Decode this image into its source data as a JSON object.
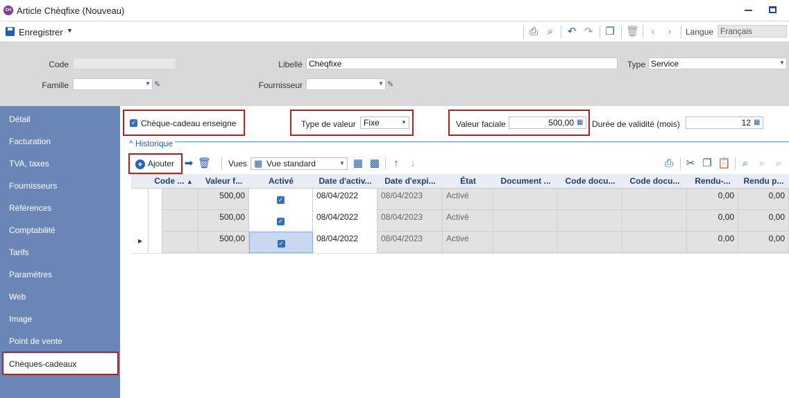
{
  "window": {
    "title": "Article Chèqfixe (Nouveau)",
    "app_badge": "CH"
  },
  "toolbar": {
    "save_label": "Enregistrer",
    "language_label": "Langue",
    "language_value": "Français"
  },
  "header": {
    "code_label": "Code",
    "code_value": "",
    "libelle_label": "Libellé",
    "libelle_value": "Chèqfixe",
    "type_label": "Type",
    "type_value": "Service",
    "famille_label": "Famille",
    "famille_value": "",
    "fournisseur_label": "Fournisseur",
    "fournisseur_value": ""
  },
  "sidebar": {
    "items": [
      {
        "label": "Détail"
      },
      {
        "label": "Facturation"
      },
      {
        "label": "TVA, taxes"
      },
      {
        "label": "Fournisseurs"
      },
      {
        "label": "Références"
      },
      {
        "label": "Comptabilité"
      },
      {
        "label": "Tarifs"
      },
      {
        "label": "Paramètres"
      },
      {
        "label": "Web"
      },
      {
        "label": "Image"
      },
      {
        "label": "Point de vente"
      },
      {
        "label": "Chèques-cadeaux"
      }
    ]
  },
  "giftcard": {
    "enseigne_label": "Chèque-cadeau enseigne",
    "type_valeur_label": "Type de valeur",
    "type_valeur_value": "Fixe",
    "valeur_faciale_label": "Valeur faciale",
    "valeur_faciale_value": "500,00",
    "duree_label": "Durée de validité (mois)",
    "duree_value": "12"
  },
  "historique": {
    "section_label": "Historique",
    "add_label": "Ajouter",
    "vues_label": "Vues",
    "vue_value": "Vue standard",
    "columns": [
      "Code ...",
      "Valeur f...",
      "Activé",
      "Date d'activ...",
      "Date d'expi...",
      "État",
      "Document ...",
      "Code docu...",
      "Code docu...",
      "Rendu-...",
      "Rendu p..."
    ],
    "rows": [
      {
        "valeur": "500,00",
        "active": true,
        "date_act": "08/04/2022",
        "date_exp": "08/04/2023",
        "etat": "Activé",
        "rendu1": "0,00",
        "rendu2": "0,00"
      },
      {
        "valeur": "500,00",
        "active": true,
        "date_act": "08/04/2022",
        "date_exp": "08/04/2023",
        "etat": "Activé",
        "rendu1": "0,00",
        "rendu2": "0,00"
      },
      {
        "valeur": "500,00",
        "active": true,
        "date_act": "08/04/2022",
        "date_exp": "08/04/2023",
        "etat": "Activé",
        "rendu1": "0,00",
        "rendu2": "0,00"
      }
    ]
  },
  "colors": {
    "sidebar_bg": "#6a86b7",
    "accent": "#1f5fae",
    "highlight_border": "#b22020",
    "header_bg": "#d9d9dc"
  }
}
